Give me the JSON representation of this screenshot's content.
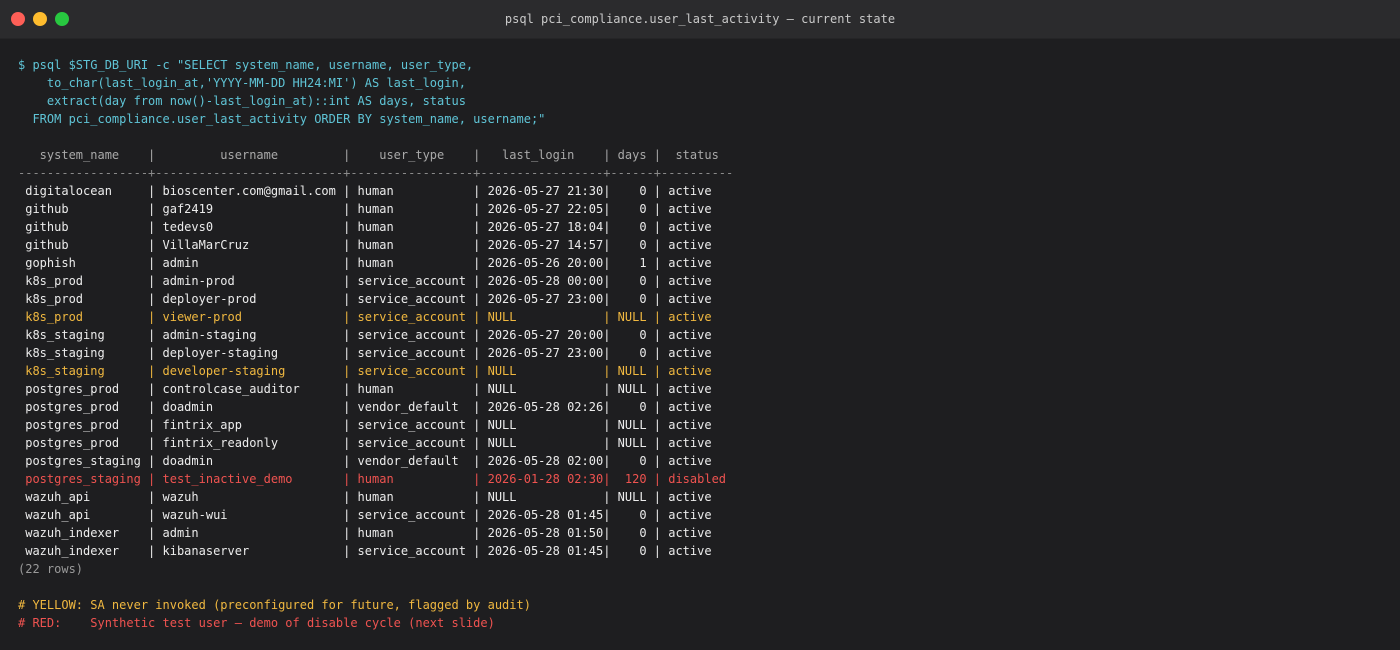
{
  "window": {
    "title": "psql pci_compliance.user_last_activity — current state"
  },
  "command": [
    "$ psql $STG_DB_URI -c \"SELECT system_name, username, user_type,",
    "    to_char(last_login_at,'YYYY-MM-DD HH24:MI') AS last_login,",
    "    extract(day from now()-last_login_at)::int AS days, status",
    "  FROM pci_compliance.user_last_activity ORDER BY system_name, username;\""
  ],
  "table": {
    "header": "   system_name    |         username         |    user_type    |   last_login    | days |  status",
    "separator": "------------------+--------------------------+-----------------+-----------------+------+----------",
    "rows": [
      {
        "text": " digitalocean     | bioscenter.com@gmail.com | human           | 2026-05-27 21:30|    0 | active",
        "highlight": "none"
      },
      {
        "text": " github           | gaf2419                  | human           | 2026-05-27 22:05|    0 | active",
        "highlight": "none"
      },
      {
        "text": " github           | tedevs0                  | human           | 2026-05-27 18:04|    0 | active",
        "highlight": "none"
      },
      {
        "text": " github           | VillaMarCruz             | human           | 2026-05-27 14:57|    0 | active",
        "highlight": "none"
      },
      {
        "text": " gophish          | admin                    | human           | 2026-05-26 20:00|    1 | active",
        "highlight": "none"
      },
      {
        "text": " k8s_prod         | admin-prod               | service_account | 2026-05-28 00:00|    0 | active",
        "highlight": "none"
      },
      {
        "text": " k8s_prod         | deployer-prod            | service_account | 2026-05-27 23:00|    0 | active",
        "highlight": "none"
      },
      {
        "text": " k8s_prod         | viewer-prod              | service_account | NULL            | NULL | active",
        "highlight": "yellow"
      },
      {
        "text": " k8s_staging      | admin-staging            | service_account | 2026-05-27 20:00|    0 | active",
        "highlight": "none"
      },
      {
        "text": " k8s_staging      | deployer-staging         | service_account | 2026-05-27 23:00|    0 | active",
        "highlight": "none"
      },
      {
        "text": " k8s_staging      | developer-staging        | service_account | NULL            | NULL | active",
        "highlight": "yellow"
      },
      {
        "text": " postgres_prod    | controlcase_auditor      | human           | NULL            | NULL | active",
        "highlight": "none"
      },
      {
        "text": " postgres_prod    | doadmin                  | vendor_default  | 2026-05-28 02:26|    0 | active",
        "highlight": "none"
      },
      {
        "text": " postgres_prod    | fintrix_app              | service_account | NULL            | NULL | active",
        "highlight": "none"
      },
      {
        "text": " postgres_prod    | fintrix_readonly         | service_account | NULL            | NULL | active",
        "highlight": "none"
      },
      {
        "text": " postgres_staging | doadmin                  | vendor_default  | 2026-05-28 02:00|    0 | active",
        "highlight": "none"
      },
      {
        "text": " postgres_staging | test_inactive_demo       | human           | 2026-01-28 02:30|  120 | disabled",
        "highlight": "red"
      },
      {
        "text": " wazuh_api        | wazuh                    | human           | NULL            | NULL | active",
        "highlight": "none"
      },
      {
        "text": " wazuh_api        | wazuh-wui                | service_account | 2026-05-28 01:45|    0 | active",
        "highlight": "none"
      },
      {
        "text": " wazuh_indexer    | admin                    | human           | 2026-05-28 01:50|    0 | active",
        "highlight": "none"
      },
      {
        "text": " wazuh_indexer    | kibanaserver             | service_account | 2026-05-28 01:45|    0 | active",
        "highlight": "none"
      }
    ],
    "row_count": "(22 rows)"
  },
  "notes": {
    "yellow": "# YELLOW: SA never invoked (preconfigured for future, flagged by audit)",
    "red": "# RED:    Synthetic test user — demo of disable cycle (next slide)"
  },
  "colors": {
    "command": "#5fc4d6",
    "yellow": "#f0b840",
    "red": "#ef5350",
    "background": "#1e1e20"
  }
}
